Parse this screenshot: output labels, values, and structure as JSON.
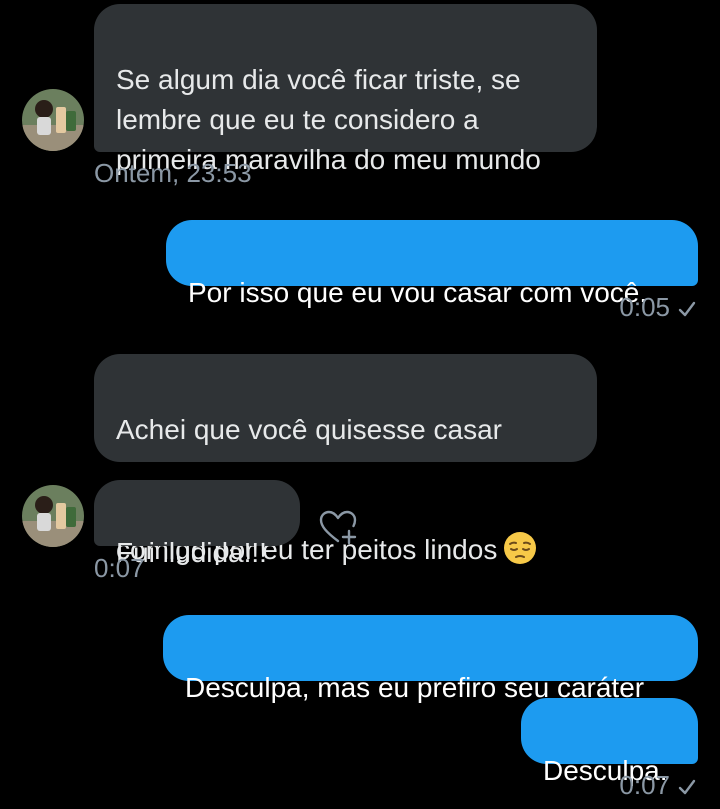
{
  "theme": {
    "background": "#000000",
    "incoming_bubble": "#2f3336",
    "outgoing_bubble": "#1d9bf0",
    "meta_text": "#8b98a5"
  },
  "messages": [
    {
      "id": 1,
      "direction": "incoming",
      "text": "Se algum dia você ficar triste, se\nlembre que eu te considero a\nprimeira maravilha do meu mundo"
    },
    {
      "id": 2,
      "direction": "incoming_meta",
      "timestamp": "Ontem, 23:53"
    },
    {
      "id": 3,
      "direction": "outgoing",
      "text": "Por isso que eu vou casar com você.",
      "timestamp": "0:05"
    },
    {
      "id": 4,
      "direction": "incoming",
      "text_line1": "Achei que você quisesse casar",
      "text_line2": "comigo por eu ter peitos lindos",
      "emoji": "pensive-face"
    },
    {
      "id": 5,
      "direction": "incoming",
      "text": "Fui iludida!!!",
      "timestamp": "0:07",
      "reaction_button_icon": "heart-plus-icon"
    },
    {
      "id": 6,
      "direction": "outgoing",
      "text": "Desculpa, mas eu prefiro seu caráter"
    },
    {
      "id": 7,
      "direction": "outgoing",
      "text": "Desculpa.",
      "timestamp": "0:07"
    }
  ],
  "status_icon": "checkmark-icon"
}
